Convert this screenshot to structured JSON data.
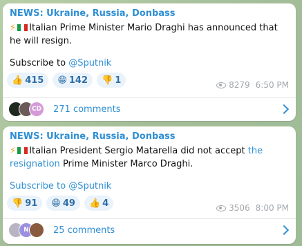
{
  "messages": [
    {
      "title": "NEWS: Ukraine, Russia, Donbass",
      "text_before_link": "Italian Prime Minister Mario Draghi has announced that he will resign.",
      "link_text": "",
      "text_after_link": "",
      "subscribe_prefix": "Subscribe to ",
      "subscribe_handle": "@Sputnik",
      "reactions": [
        {
          "emoji": "👍",
          "count": "415"
        },
        {
          "emoji": "😁",
          "count": "142"
        },
        {
          "emoji": "👎",
          "count": "1"
        }
      ],
      "views": "8279",
      "time": "6:50 PM",
      "comments": "271 comments",
      "avatar_initials": [
        "",
        "",
        "CD"
      ]
    },
    {
      "title": "NEWS: Ukraine, Russia, Donbass",
      "text_before_link": "Italian President Sergio Matarella did not accept ",
      "link_text": "the resignation",
      "text_after_link": " Prime Minister Marco Draghi.",
      "subscribe_prefix": "Subscribe to ",
      "subscribe_handle": "@Sputnik",
      "reactions": [
        {
          "emoji": "👎",
          "count": "91"
        },
        {
          "emoji": "😁",
          "count": "49"
        },
        {
          "emoji": "👍",
          "count": "4"
        }
      ],
      "views": "3506",
      "time": "8:00 PM",
      "comments": "25 comments",
      "avatar_initials": [
        "",
        "N",
        ""
      ]
    }
  ],
  "colors": {
    "link": "#2f8fd3",
    "reaction_bg": "#eaf3fb",
    "meta": "#a3a8ad"
  }
}
